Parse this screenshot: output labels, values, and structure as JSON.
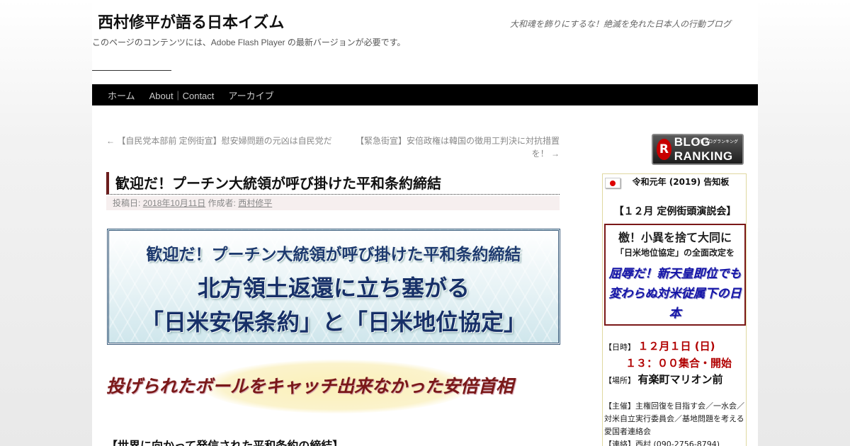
{
  "site": {
    "title": "西村修平が語る日本イズム",
    "description": "大和魂を飾りにするな！絶滅を免れた日本人の行動ブログ",
    "flash_notice": "このページのコンテンツには、Adobe Flash Player の最新バージョンが必要です。"
  },
  "nav": {
    "items": [
      {
        "label": "ホーム"
      },
      {
        "label": "About｜Contact"
      },
      {
        "label": "アーカイブ"
      }
    ]
  },
  "post_nav": {
    "prev": "← 【自民党本部前 定例街宣】慰安婦問題の元凶は自民党だ",
    "next": "【緊急街宣】安倍政権は韓国の徴用工判決に対抗措置を！ →"
  },
  "post": {
    "title": "歓迎だ！プーチン大統領が呼び掛けた平和条約締結",
    "meta_posted_label": "投稿日:",
    "meta_date": "2018年10月11日",
    "meta_author_label": "作成者:",
    "meta_author": "西村修平",
    "banner": {
      "line1": "歓迎だ！プーチン大統領が呼び掛けた平和条約締結",
      "line2": "北方領土返還に立ち塞がる",
      "line3": "「日米安保条約」と「日米地位協定」"
    },
    "catch": "投げられたボールをキャッチ出来なかった安倍首相",
    "section_heading": "【世界に向かって発信された平和条約の締結】"
  },
  "sidebar": {
    "ranking_badge": "BLOG RANKING",
    "ranking_small": "人気ブログランキング",
    "notice": {
      "title": "令和元年 (2019) 告知板",
      "heading": "【１２月 定例街頭演説会】",
      "box_line1": "檄！小異を捨て大同に",
      "box_line2": "「日米地位協定」の全面改定を",
      "box_line3": "屈辱だ！新天皇即位でも変わらぬ対米従属下の日本",
      "date_label": "【日時】",
      "date_value": "１２月１日 (日)",
      "time_value": "１３：００集合・開始",
      "place_label": "【場所】",
      "place_value": "有楽町マリオン前",
      "organizer": "【主催】主権回復を目指す会／一水会／対米自立実行委員会／基地問題を考える愛国者連絡会",
      "contact": "【連絡】西村 (090-2756-8794)"
    }
  }
}
